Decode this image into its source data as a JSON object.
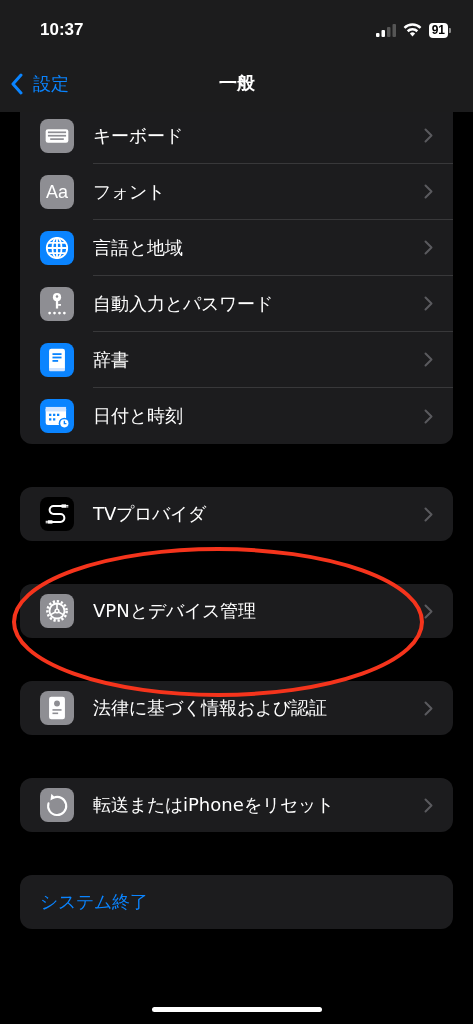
{
  "status_bar": {
    "time": "10:37",
    "battery": "91"
  },
  "nav": {
    "back": "設定",
    "title": "一般"
  },
  "groups": [
    {
      "rows": [
        {
          "kind": "keyboard",
          "label": "キーボード"
        },
        {
          "kind": "font",
          "icon_text": "Aa",
          "label": "フォント"
        },
        {
          "kind": "globe",
          "label": "言語と地域"
        },
        {
          "kind": "key",
          "label": "自動入力とパスワード"
        },
        {
          "kind": "book",
          "label": "辞書"
        },
        {
          "kind": "calendar",
          "label": "日付と時刻"
        }
      ]
    },
    {
      "rows": [
        {
          "kind": "cable",
          "label": "TVプロバイダ"
        }
      ]
    },
    {
      "rows": [
        {
          "kind": "gear",
          "label": "VPNとデバイス管理"
        }
      ]
    },
    {
      "rows": [
        {
          "kind": "certificate",
          "label": "法律に基づく情報および認証"
        }
      ]
    },
    {
      "rows": [
        {
          "kind": "reset",
          "label": "転送またはiPhoneをリセット"
        }
      ]
    },
    {
      "rows": [
        {
          "kind": "action",
          "label": "システム終了"
        }
      ]
    }
  ],
  "annotation": {
    "kind": "ellipse"
  }
}
